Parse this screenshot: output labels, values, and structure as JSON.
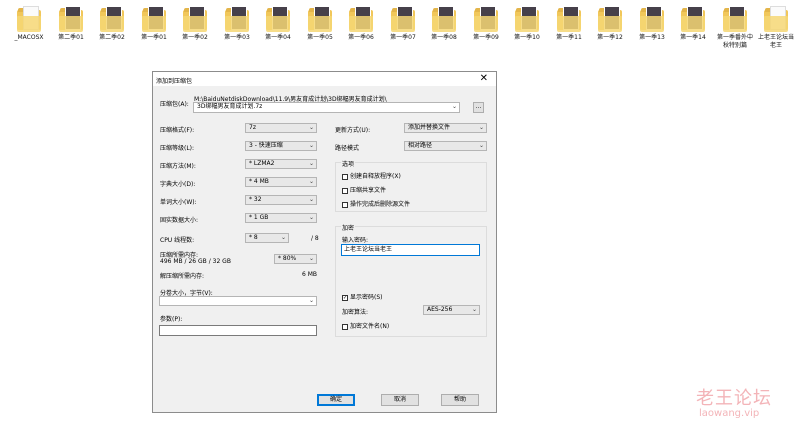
{
  "desktop": {
    "folders": [
      {
        "label": "_MACOSX",
        "type": "plain"
      },
      {
        "label": "第二季01",
        "type": "pic"
      },
      {
        "label": "第二季02",
        "type": "pic"
      },
      {
        "label": "第一季01",
        "type": "pic"
      },
      {
        "label": "第一季02",
        "type": "pic"
      },
      {
        "label": "第一季03",
        "type": "pic"
      },
      {
        "label": "第一季04",
        "type": "pic"
      },
      {
        "label": "第一季05",
        "type": "pic"
      },
      {
        "label": "第一季06",
        "type": "pic"
      },
      {
        "label": "第一季07",
        "type": "pic"
      },
      {
        "label": "第一季08",
        "type": "pic"
      },
      {
        "label": "第一季09",
        "type": "pic"
      },
      {
        "label": "第一季10",
        "type": "pic"
      },
      {
        "label": "第一季11",
        "type": "pic"
      },
      {
        "label": "第一季12",
        "type": "pic"
      },
      {
        "label": "第一季13",
        "type": "pic"
      },
      {
        "label": "第一季14",
        "type": "pic"
      },
      {
        "label": "第一季番外中秋特别篇",
        "type": "pic"
      },
      {
        "label": "上老王论坛当老王",
        "type": "plain"
      }
    ]
  },
  "dialog": {
    "title": "添加到压缩包",
    "close": "✕",
    "archive_label": "压缩包(A):",
    "archive_path": "M:\\BaiduNetdiskDownload\\11.9\\男友育成计划\\3D绑幅男友育成计划\\",
    "archive_name": "3D绑幅男友育成计划.7z",
    "browse_label": "...",
    "format_label": "压缩格式(F):",
    "format_value": "7z",
    "level_label": "压缩等级(L):",
    "level_value": "3 - 快速压缩",
    "method_label": "压缩方法(M):",
    "method_value": "* LZMA2",
    "dict_label": "字典大小(D):",
    "dict_value": "* 4 MB",
    "word_label": "单词大小(W):",
    "word_value": "* 32",
    "solid_label": "固实数据大小:",
    "solid_value": "* 1 GB",
    "threads_label": "CPU 线程数:",
    "threads_value": "* 8",
    "threads_max": "/ 8",
    "mem_label": "压缩所需内存:",
    "mem_detail": "496 MB / 26 GB / 32 GB",
    "mem_percent": "* 80%",
    "decomp_label": "解压缩所需内存:",
    "decomp_value": "6 MB",
    "split_label": "分卷大小，字节(V):",
    "split_value": "",
    "params_label": "参数(P):",
    "params_value": "",
    "update_label": "更新方式(U):",
    "update_value": "添加并替换文件",
    "pathmode_label": "路径模式",
    "pathmode_value": "相对路径",
    "options_title": "选项",
    "opt_sfx": "创建自释放程序(X)",
    "opt_shared": "压缩共享文件",
    "opt_delete": "操作完成后删除源文件",
    "enc_title": "加密",
    "password_label": "输入密码:",
    "password_value": "上老王论坛当老王",
    "show_pw_label": "显示密码(S)",
    "show_pw_checked": "✓",
    "enc_method_label": "加密算法:",
    "enc_method_value": "AES-256",
    "enc_names_label": "加密文件名(N)",
    "ok": "确定",
    "cancel": "取消",
    "help": "帮助"
  },
  "watermark": {
    "line1": "老王论坛",
    "line2": "laowang.vip"
  }
}
